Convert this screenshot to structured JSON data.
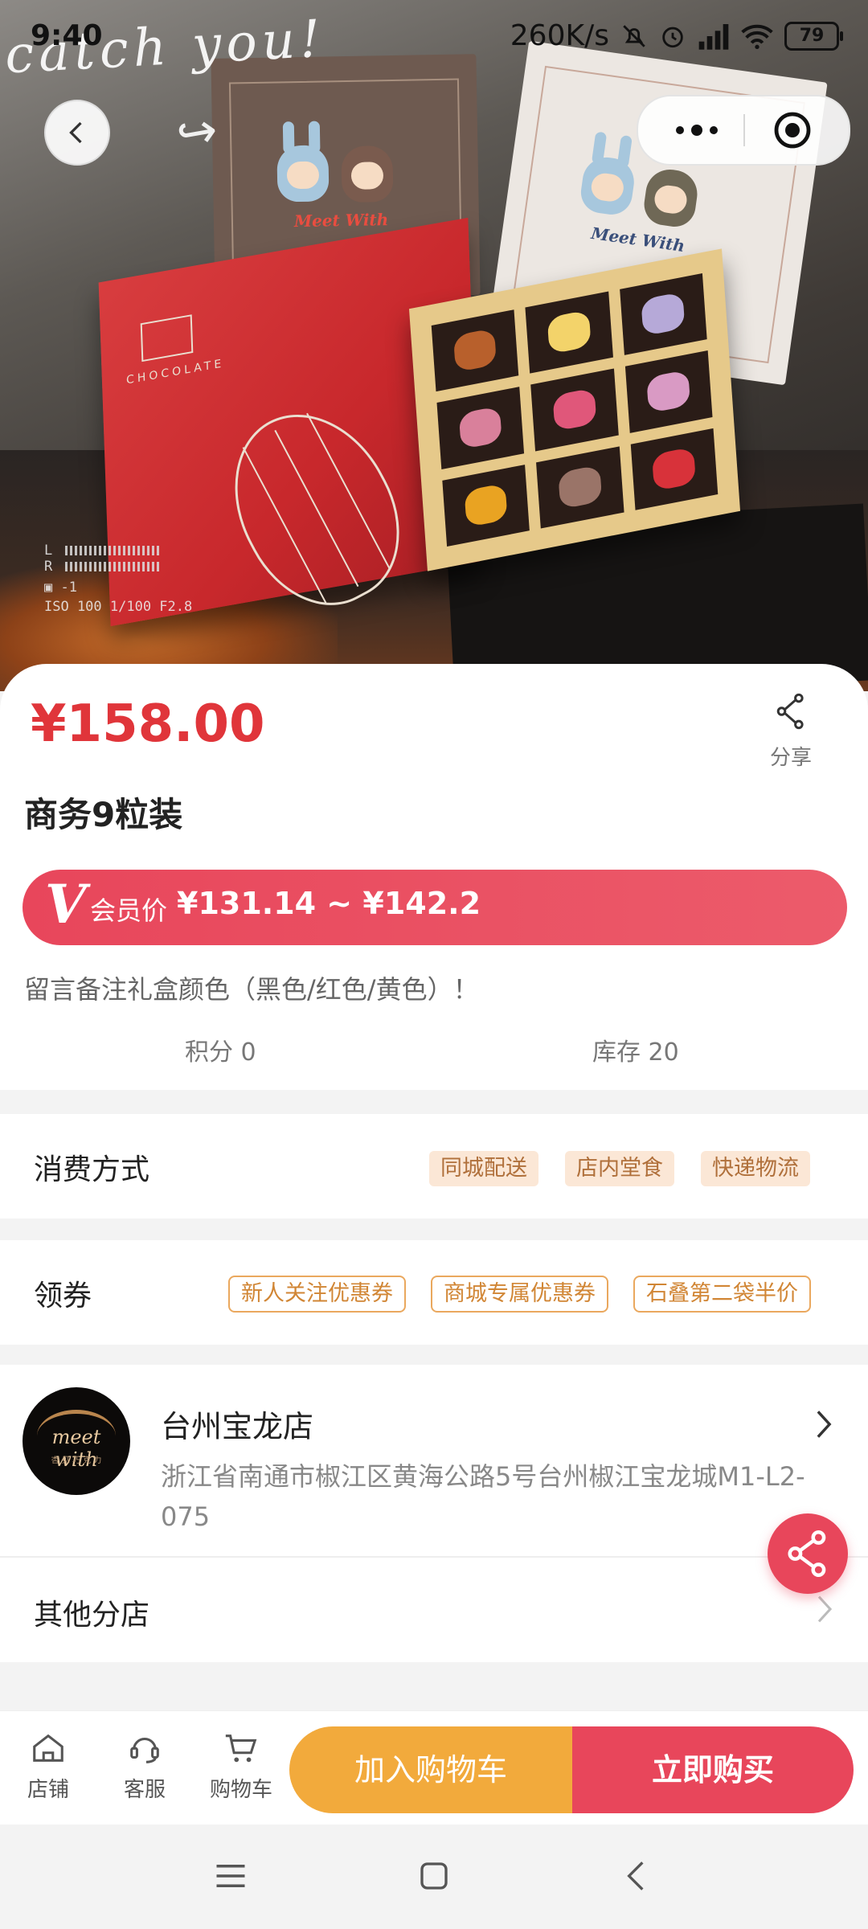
{
  "status_bar": {
    "time": "9:40",
    "network_speed": "260K/s",
    "battery": "79"
  },
  "hero": {
    "overlay_text": "catch you!",
    "brand_text": "Meet With",
    "box_text": "CHOCOLATE",
    "camera_info": "ISO 100 1/100 F2.8"
  },
  "product": {
    "price": "¥158.00",
    "title": "商务9粒装",
    "share_label": "分享",
    "vip_label": "会员价",
    "vip_range": "¥131.14 ~ ¥142.2",
    "note": "留言备注礼盒颜色（黑色/红色/黄色）！",
    "points": "积分 0",
    "stock": "库存 20"
  },
  "consumption": {
    "label": "消费方式",
    "options": [
      "同城配送",
      "店内堂食",
      "快递物流"
    ]
  },
  "coupons": {
    "label": "领券",
    "items": [
      "新人关注优惠券",
      "商城专属优惠券",
      "石叠第二袋半价"
    ]
  },
  "store": {
    "name": "台州宝龙店",
    "address": "浙江省南通市椒江区黄海公路5号台州椒江宝龙城M1-L2-075",
    "logo_text": "meet with",
    "logo_sub": "杏 见 巧 克 力",
    "other_branches": "其他分店"
  },
  "bottom_bar": {
    "tab_store": "店铺",
    "tab_service": "客服",
    "tab_cart": "购物车",
    "add_to_cart": "加入购物车",
    "buy_now": "立即购买"
  },
  "colors": {
    "price_red": "#e0353a",
    "accent_pink": "#e8465b",
    "cart_orange": "#f2aa3c",
    "chip_bg": "#fbe7d6",
    "coupon_border": "#eaa85e"
  }
}
